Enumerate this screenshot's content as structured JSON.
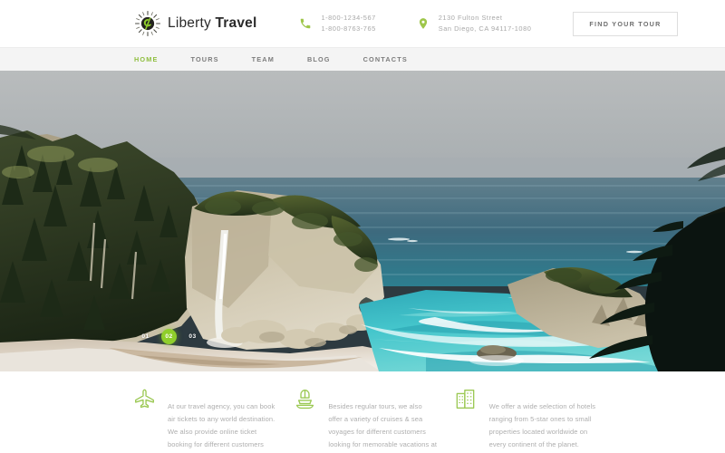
{
  "header": {
    "brand": {
      "thin": "Liberty",
      "bold": "Travel",
      "logo_icon": "sun-compass-logo-icon"
    },
    "phone": {
      "icon": "phone-icon",
      "line1": "1-800-1234-567",
      "line2": "1-800-8763-765"
    },
    "address": {
      "icon": "map-pin-icon",
      "line1": "2130 Fulton Street",
      "line2": "San Diego, CA 94117-1080"
    },
    "cta_label": "FIND YOUR TOUR"
  },
  "nav": {
    "items": [
      {
        "label": "HOME",
        "active": true
      },
      {
        "label": "TOURS",
        "active": false
      },
      {
        "label": "TEAM",
        "active": false
      },
      {
        "label": "BLOG",
        "active": false
      },
      {
        "label": "CONTACTS",
        "active": false
      }
    ]
  },
  "hero": {
    "alt": "Coastal cove with waterfall, cliffs, sandy beach and turquoise ocean",
    "slider": {
      "dots": [
        {
          "label": "01",
          "active": false
        },
        {
          "label": "02",
          "active": true
        },
        {
          "label": "03",
          "active": false
        }
      ]
    }
  },
  "features": [
    {
      "icon": "airplane-icon",
      "text": "At our travel agency, you can book air tickets to any world destination. We also provide online ticket booking for different customers looking for comfortable flights."
    },
    {
      "icon": "cruise-ship-icon",
      "text": "Besides regular tours, we also offer a variety of cruises & sea voyages for different customers looking for memorable vacations at sea."
    },
    {
      "icon": "hotel-building-icon",
      "text": "We offer a wide selection of hotels ranging from 5-star ones to small properties located worldwide on every continent of the planet."
    }
  ],
  "colors": {
    "accent_green": "#8fbe3f",
    "dot_green": "#8fce2b",
    "icon_green": "#9cc955",
    "nav_bg": "#f4f4f4",
    "muted_text": "#aeaeae",
    "water_turquoise": "#3ec5cc",
    "sand": "#d8cdbc"
  }
}
